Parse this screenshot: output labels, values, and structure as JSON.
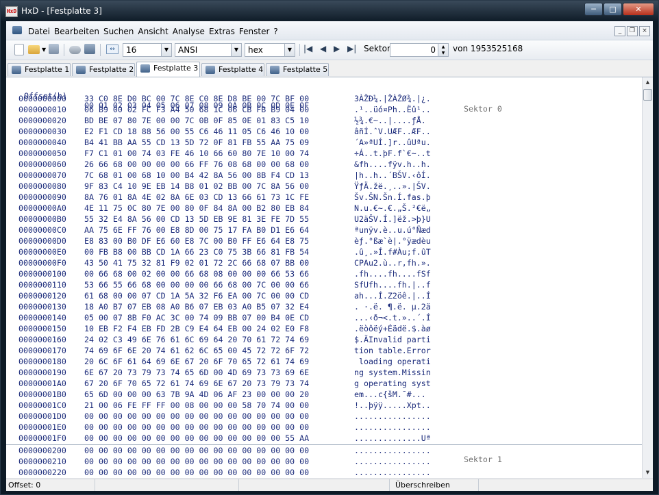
{
  "window": {
    "title": "HxD - [Festplatte 3]",
    "icon": "hxd-app-icon"
  },
  "menubar": {
    "items": [
      "Datei",
      "Bearbeiten",
      "Suchen",
      "Ansicht",
      "Analyse",
      "Extras",
      "Fenster",
      "?"
    ]
  },
  "toolbar": {
    "columns_value": "16",
    "charset_value": "ANSI",
    "offset_base_value": "hex",
    "sector_label": "Sektor",
    "sector_value": "0",
    "sector_total": "von 1953525168"
  },
  "tabs": [
    {
      "label": "Festplatte 1",
      "active": false
    },
    {
      "label": "Festplatte 2",
      "active": false
    },
    {
      "label": "Festplatte 3",
      "active": true
    },
    {
      "label": "Festplatte 4",
      "active": false
    },
    {
      "label": "Festplatte 5",
      "active": false
    }
  ],
  "editor": {
    "header_offset": "Offset(h)",
    "header_hex": "00 01 02 03 04 05 06 07 08 09 0A 0B 0C 0D 0E 0F",
    "sector0_label": "Sektor 0",
    "sector1_label": "Sektor 1",
    "rows": [
      {
        "offset": "0000000000",
        "hex": "33 C0 8E D0 BC 00 7C 8E C0 8E D8 BE 00 7C BF 00",
        "ascii": "3ÀŽÐ¼.|ŽÀŽØ¾.|¿."
      },
      {
        "offset": "0000000010",
        "hex": "06 B9 00 02 FC F3 A4 50 68 1C 06 CB FB B9 04 00",
        "ascii": ".¹..üó¤Ph..Ëû¹.."
      },
      {
        "offset": "0000000020",
        "hex": "BD BE 07 80 7E 00 00 7C 0B 0F 85 0E 01 83 C5 10",
        "ascii": "½¾.€~..|....ƒÅ."
      },
      {
        "offset": "0000000030",
        "hex": "E2 F1 CD 18 88 56 00 55 C6 46 11 05 C6 46 10 00",
        "ascii": "âñÍ.ˆV.UÆF..ÆF.."
      },
      {
        "offset": "0000000040",
        "hex": "B4 41 BB AA 55 CD 13 5D 72 0F 81 FB 55 AA 75 09",
        "ascii": "´A»ªUÍ.]r..ûUªu."
      },
      {
        "offset": "0000000050",
        "hex": "F7 C1 01 00 74 03 FE 46 10 66 60 80 7E 10 00 74",
        "ascii": "÷Á..t.þF.f`€~..t"
      },
      {
        "offset": "0000000060",
        "hex": "26 66 68 00 00 00 00 66 FF 76 08 68 00 00 68 00",
        "ascii": "&fh....fÿv.h..h."
      },
      {
        "offset": "0000000070",
        "hex": "7C 68 01 00 68 10 00 B4 42 8A 56 00 8B F4 CD 13",
        "ascii": "|h..h..´BŠV.‹ôÍ."
      },
      {
        "offset": "0000000080",
        "hex": "9F 83 C4 10 9E EB 14 B8 01 02 BB 00 7C 8A 56 00",
        "ascii": "ŸƒÄ.žë.¸..».|ŠV."
      },
      {
        "offset": "0000000090",
        "hex": "8A 76 01 8A 4E 02 8A 6E 03 CD 13 66 61 73 1C FE",
        "ascii": "Šv.ŠN.Šn.Í.fas.þ"
      },
      {
        "offset": "00000000A0",
        "hex": "4E 11 75 0C 80 7E 00 80 0F 84 8A 00 B2 80 EB 84",
        "ascii": "N.u.€~.€.„Š.²€ë„"
      },
      {
        "offset": "00000000B0",
        "hex": "55 32 E4 8A 56 00 CD 13 5D EB 9E 81 3E FE 7D 55",
        "ascii": "U2äŠV.Í.]ëž.>þ}U"
      },
      {
        "offset": "00000000C0",
        "hex": "AA 75 6E FF 76 00 E8 8D 00 75 17 FA B0 D1 E6 64",
        "ascii": "ªunÿv.è..u.ú°Ñæd"
      },
      {
        "offset": "00000000D0",
        "hex": "E8 83 00 B0 DF E6 60 E8 7C 00 B0 FF E6 64 E8 75",
        "ascii": "èƒ.°ßæ`è|.°ÿædèu"
      },
      {
        "offset": "00000000E0",
        "hex": "00 FB B8 00 BB CD 1A 66 23 C0 75 3B 66 81 FB 54",
        "ascii": ".û¸.»Í.f#Àu;f.ûT"
      },
      {
        "offset": "00000000F0",
        "hex": "43 50 41 75 32 81 F9 02 01 72 2C 66 68 07 BB 00",
        "ascii": "CPAu2.ù..r,fh.»."
      },
      {
        "offset": "0000000100",
        "hex": "00 66 68 00 02 00 00 66 68 08 00 00 00 66 53 66",
        "ascii": ".fh....fh....fSf"
      },
      {
        "offset": "0000000110",
        "hex": "53 66 55 66 68 00 00 00 00 66 68 00 7C 00 00 66",
        "ascii": "SfUfh....fh.|..f"
      },
      {
        "offset": "0000000120",
        "hex": "61 68 00 00 07 CD 1A 5A 32 F6 EA 00 7C 00 00 CD",
        "ascii": "ah...Í.Z2öê.|..Í"
      },
      {
        "offset": "0000000130",
        "hex": "18 A0 B7 07 EB 08 A0 B6 07 EB 03 A0 B5 07 32 E4",
        "ascii": ". ·.ë. ¶.ë. µ.2ä"
      },
      {
        "offset": "0000000140",
        "hex": "05 00 07 8B F0 AC 3C 00 74 09 BB 07 00 B4 0E CD",
        "ascii": "...‹ð¬<.t.»..´.Í"
      },
      {
        "offset": "0000000150",
        "hex": "10 EB F2 F4 EB FD 2B C9 E4 64 EB 00 24 02 E0 F8",
        "ascii": ".ëòôëý+Éädë.$.àø"
      },
      {
        "offset": "0000000160",
        "hex": "24 02 C3 49 6E 76 61 6C 69 64 20 70 61 72 74 69",
        "ascii": "$.ÃInvalid parti"
      },
      {
        "offset": "0000000170",
        "hex": "74 69 6F 6E 20 74 61 62 6C 65 00 45 72 72 6F 72",
        "ascii": "tion table.Error"
      },
      {
        "offset": "0000000180",
        "hex": "20 6C 6F 61 64 69 6E 67 20 6F 70 65 72 61 74 69",
        "ascii": " loading operati"
      },
      {
        "offset": "0000000190",
        "hex": "6E 67 20 73 79 73 74 65 6D 00 4D 69 73 73 69 6E",
        "ascii": "ng system.Missin"
      },
      {
        "offset": "00000001A0",
        "hex": "67 20 6F 70 65 72 61 74 69 6E 67 20 73 79 73 74",
        "ascii": "g operating syst"
      },
      {
        "offset": "00000001B0",
        "hex": "65 6D 00 00 00 63 7B 9A 4D 06 AF 23 00 00 00 20",
        "ascii": "em...c{šM.¯#... "
      },
      {
        "offset": "00000001C0",
        "hex": "21 00 06 FE FF FF 00 08 00 00 00 58 70 74 00 00",
        "ascii": "!..þÿÿ.....Xpt.."
      },
      {
        "offset": "00000001D0",
        "hex": "00 00 00 00 00 00 00 00 00 00 00 00 00 00 00 00",
        "ascii": "................"
      },
      {
        "offset": "00000001E0",
        "hex": "00 00 00 00 00 00 00 00 00 00 00 00 00 00 00 00",
        "ascii": "................"
      },
      {
        "offset": "00000001F0",
        "hex": "00 00 00 00 00 00 00 00 00 00 00 00 00 00 55 AA",
        "ascii": "..............Uª"
      },
      {
        "offset": "0000000200",
        "hex": "00 00 00 00 00 00 00 00 00 00 00 00 00 00 00 00",
        "ascii": "................"
      },
      {
        "offset": "0000000210",
        "hex": "00 00 00 00 00 00 00 00 00 00 00 00 00 00 00 00",
        "ascii": "................"
      },
      {
        "offset": "0000000220",
        "hex": "00 00 00 00 00 00 00 00 00 00 00 00 00 00 00 00",
        "ascii": "................"
      }
    ]
  },
  "statusbar": {
    "offset": "Offset: 0",
    "mode": "Überschreiben"
  },
  "colors": {
    "text_blue": "#1a2a7a",
    "sector_gray": "#707070",
    "title_dark": "#0f1c28"
  }
}
